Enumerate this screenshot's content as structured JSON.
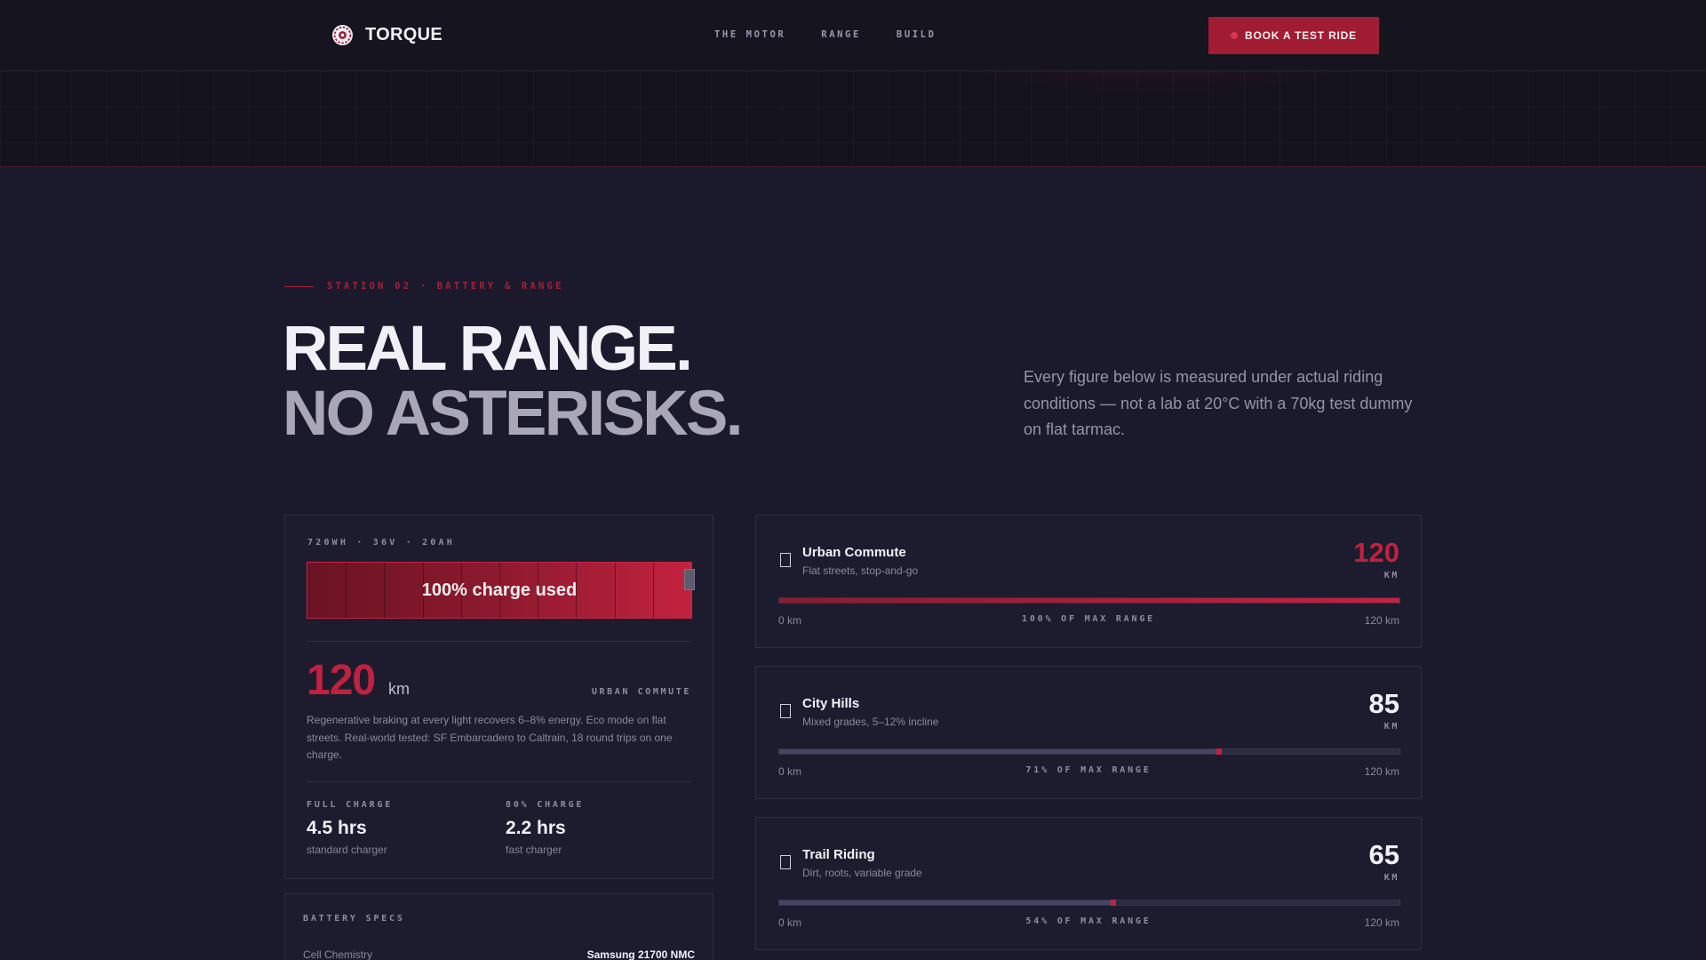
{
  "nav": {
    "brand": "TORQUE",
    "links": [
      "THE MOTOR",
      "RANGE",
      "BUILD"
    ],
    "cta": "BOOK A TEST RIDE"
  },
  "intro": {
    "eyebrow": "STATION 02 · BATTERY & RANGE",
    "headline_line1": "REAL RANGE.",
    "headline_line2": "NO ASTERISKS.",
    "description": "Every figure below is measured under actual riding conditions — not a lab at 20°C with a 70kg test dummy on flat tarmac."
  },
  "battery": {
    "spec_code": "720WH · 36V · 20AH",
    "charge_used_label": "100% charge used",
    "charge_used_fraction": 1.0,
    "segments": 10,
    "range_value": "120",
    "range_unit": "km",
    "mode": "URBAN COMMUTE",
    "description": "Regenerative braking at every light recovers 6–8% energy. Eco mode on flat streets. Real-world tested: SF Embarcadero to Caltrain, 18 round trips on one charge.",
    "full_charge": {
      "label": "FULL CHARGE",
      "value": "4.5 hrs",
      "sub": "standard charger"
    },
    "fast_charge": {
      "label": "80% CHARGE",
      "value": "2.2 hrs",
      "sub": "fast charger"
    }
  },
  "specs": {
    "title": "BATTERY SPECS",
    "rows": [
      {
        "label": "Cell Chemistry",
        "value": "Samsung 21700 NMC"
      }
    ]
  },
  "routes": [
    {
      "name": "Urban Commute",
      "sub": "Flat streets, stop-and-go",
      "km": "120",
      "unit": "KM",
      "fraction": 1.0,
      "pct_label": "100% OF MAX RANGE",
      "min": "0 km",
      "max": "120 km",
      "color": "#c0213f"
    },
    {
      "name": "City Hills",
      "sub": "Mixed grades, 5–12% incline",
      "km": "85",
      "unit": "KM",
      "fraction": 0.71,
      "pct_label": "71% OF MAX RANGE",
      "min": "0 km",
      "max": "120 km",
      "color": "#f2f0f7"
    },
    {
      "name": "Trail Riding",
      "sub": "Dirt, roots, variable grade",
      "km": "65",
      "unit": "KM",
      "fraction": 0.54,
      "pct_label": "54% OF MAX RANGE",
      "min": "0 km",
      "max": "120 km",
      "color": "#f2f0f7"
    }
  ],
  "icons": {
    "brand": "wheel-logo-icon",
    "cta": "dot-icon",
    "route_select": "checkbox-icon"
  },
  "colors": {
    "accent": "#c0213f",
    "accent_dark": "#a01c33",
    "background": "#1b1a2c",
    "card": "#1d1c2f"
  }
}
